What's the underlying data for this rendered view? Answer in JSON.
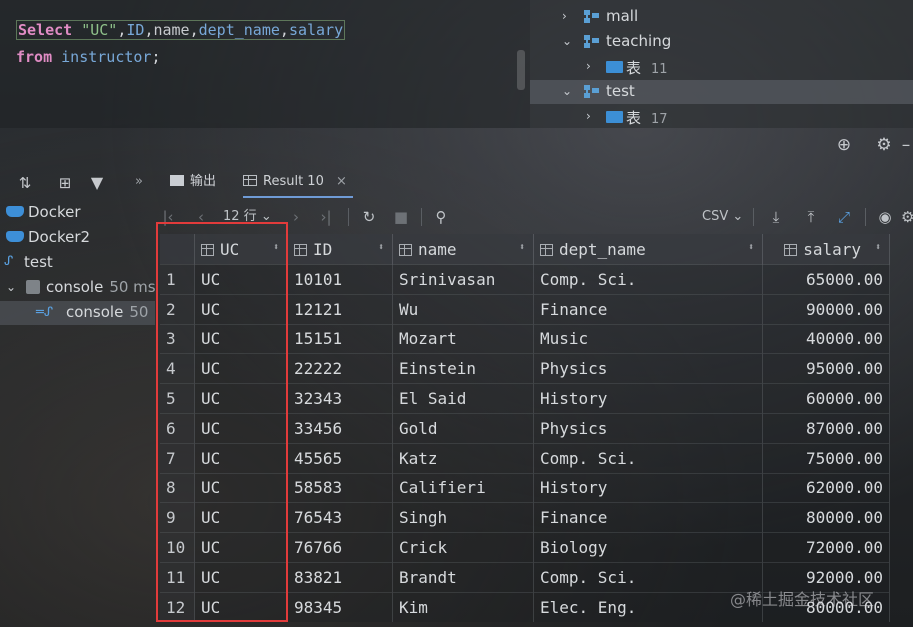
{
  "editor": {
    "line1": [
      {
        "t": "Select",
        "c": "kw"
      },
      {
        "t": " ",
        "c": "plain"
      },
      {
        "t": "\"UC\"",
        "c": "str"
      },
      {
        "t": ",",
        "c": "plain"
      },
      {
        "t": "ID",
        "c": "col"
      },
      {
        "t": ",",
        "c": "plain"
      },
      {
        "t": "name",
        "c": "ident"
      },
      {
        "t": ",",
        "c": "plain"
      },
      {
        "t": "dept_name",
        "c": "col"
      },
      {
        "t": ",",
        "c": "plain"
      },
      {
        "t": "salary",
        "c": "col"
      }
    ],
    "line2": [
      {
        "t": "from",
        "c": "kw"
      },
      {
        "t": " ",
        "c": "plain"
      },
      {
        "t": "instructor",
        "c": "col"
      },
      {
        "t": ";",
        "c": "plain"
      }
    ]
  },
  "tree": {
    "items": [
      {
        "label": "mall",
        "count": "",
        "chevron": "›",
        "icon": "database-icon",
        "selected": false
      },
      {
        "label": "teaching",
        "count": "",
        "chevron": "⌄",
        "icon": "database-icon",
        "selected": false
      },
      {
        "label": "表",
        "count": "11",
        "chevron": "›",
        "icon": "folder-icon",
        "selected": false
      },
      {
        "label": "test",
        "count": "",
        "chevron": "⌄",
        "icon": "database-icon",
        "selected": true
      },
      {
        "label": "表",
        "count": "17",
        "chevron": "›",
        "icon": "folder-icon",
        "selected": false
      }
    ]
  },
  "services": {
    "items": [
      {
        "label": "Docker",
        "time": "",
        "icon": "docker-icon"
      },
      {
        "label": "Docker2",
        "time": "",
        "icon": "docker-icon"
      },
      {
        "label": "test",
        "time": "",
        "icon": "datasource-icon"
      },
      {
        "label": "console",
        "time": "50 ms",
        "icon": "console-icon"
      },
      {
        "label": "console",
        "time": "50",
        "icon": "console-file-icon"
      }
    ]
  },
  "tabs": {
    "more": "»",
    "output_label": "输出",
    "result_label": "Result 10",
    "close": "×"
  },
  "result_toolbar": {
    "rows_label": "12 行",
    "export_format": "CSV"
  },
  "grid": {
    "columns": [
      "UC",
      "ID",
      "name",
      "dept_name",
      "salary"
    ],
    "rows": [
      [
        "1",
        "UC",
        "10101",
        "Srinivasan",
        "Comp. Sci.",
        "65000.00"
      ],
      [
        "2",
        "UC",
        "12121",
        "Wu",
        "Finance",
        "90000.00"
      ],
      [
        "3",
        "UC",
        "15151",
        "Mozart",
        "Music",
        "40000.00"
      ],
      [
        "4",
        "UC",
        "22222",
        "Einstein",
        "Physics",
        "95000.00"
      ],
      [
        "5",
        "UC",
        "32343",
        "El Said",
        "History",
        "60000.00"
      ],
      [
        "6",
        "UC",
        "33456",
        "Gold",
        "Physics",
        "87000.00"
      ],
      [
        "7",
        "UC",
        "45565",
        "Katz",
        "Comp. Sci.",
        "75000.00"
      ],
      [
        "8",
        "UC",
        "58583",
        "Califieri",
        "History",
        "62000.00"
      ],
      [
        "9",
        "UC",
        "76543",
        "Singh",
        "Finance",
        "80000.00"
      ],
      [
        "10",
        "UC",
        "76766",
        "Crick",
        "Biology",
        "72000.00"
      ],
      [
        "11",
        "UC",
        "83821",
        "Brandt",
        "Comp. Sci.",
        "92000.00"
      ],
      [
        "12",
        "UC",
        "98345",
        "Kim",
        "Elec. Eng.",
        "80000.00"
      ]
    ]
  },
  "watermark": "@稀土掘金技术社区",
  "colors": {
    "highlight": "#e23b3b",
    "accent": "#6f9bd6"
  }
}
